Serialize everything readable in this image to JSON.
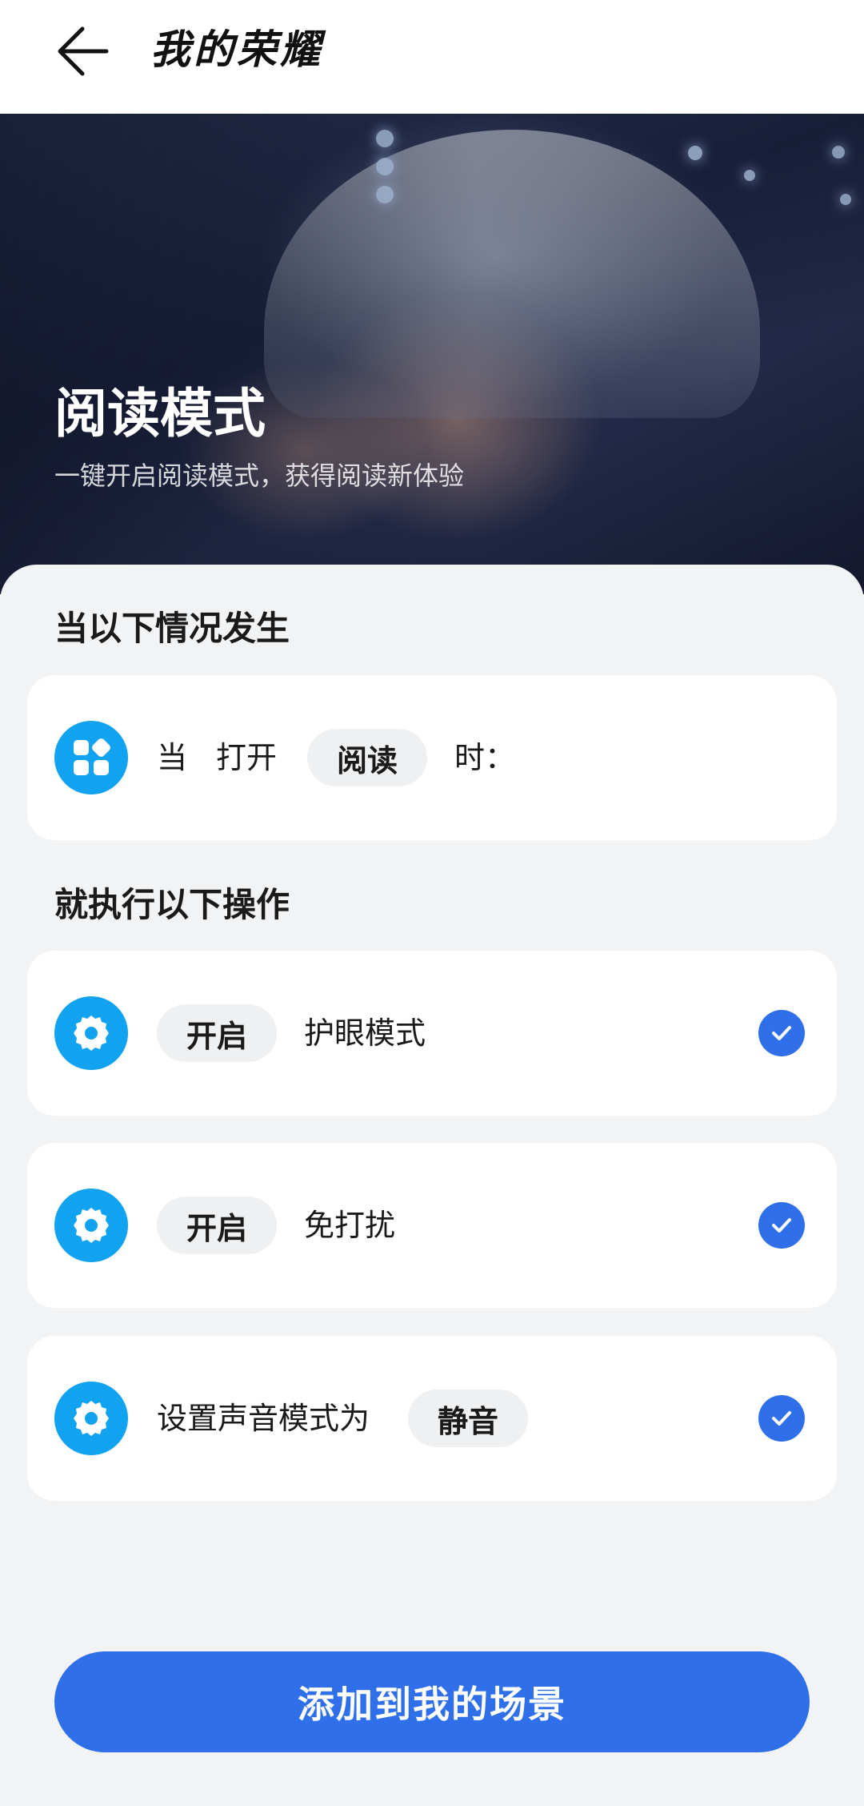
{
  "header": {
    "title": "我的荣耀",
    "back_icon": "arrow-left-icon"
  },
  "hero": {
    "title": "阅读模式",
    "subtitle": "一键开启阅读模式，获得阅读新体验"
  },
  "trigger_section": {
    "title": "当以下情况发生",
    "condition": {
      "icon": "app-grid-icon",
      "prefix": "当",
      "verb": "打开",
      "app": "阅读",
      "suffix": "时："
    }
  },
  "actions_section": {
    "title": "就执行以下操作",
    "actions": [
      {
        "icon": "settings-gear-icon",
        "chip": "开启",
        "text": "护眼模式",
        "checked": true
      },
      {
        "icon": "settings-gear-icon",
        "chip": "开启",
        "text": "免打扰",
        "checked": true
      },
      {
        "icon": "settings-gear-icon",
        "text": "设置声音模式为",
        "chip": "静音",
        "checked": true
      }
    ]
  },
  "footer": {
    "button_label": "添加到我的场景"
  },
  "colors": {
    "accent": "#2f6fea",
    "icon_blue": "#12a3f0",
    "chip_bg": "#eef0f2",
    "page_bg": "#f1f3f5"
  }
}
